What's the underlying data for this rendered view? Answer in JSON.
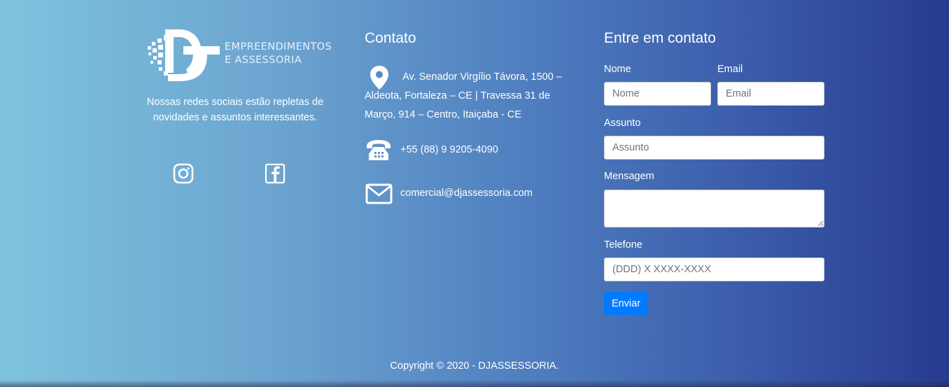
{
  "brand": {
    "logo_line1": "EMPREENDIMENTOS",
    "logo_line2": "E ASSESSORIA",
    "tagline": "Nossas redes sociais estão repletas de novidades e assuntos interessantes.",
    "social": [
      {
        "name": "instagram-icon"
      },
      {
        "name": "facebook-icon"
      }
    ]
  },
  "contact": {
    "title": "Contato",
    "address": "Av. Senador Virgílio Távora, 1500 – Aldeota, Fortaleza – CE | Travessa 31 de Março, 914 – Centro, Itaiçaba - CE",
    "phone": "+55 (88) 9 9205-4090",
    "email": "comercial@djassessoria.com",
    "icons": [
      "map-pin-icon",
      "telephone-icon",
      "envelope-icon"
    ]
  },
  "form": {
    "title": "Entre em contato",
    "name_label": "Nome",
    "name_placeholder": "Nome",
    "email_label": "Email",
    "email_placeholder": "Email",
    "subject_label": "Assunto",
    "subject_placeholder": "Assunto",
    "message_label": "Mensagem",
    "phone_label": "Telefone",
    "phone_placeholder": "(DDD) X XXXX-XXXX",
    "submit_label": "Enviar",
    "submit_color": "#007bff"
  },
  "footer": {
    "copyright": "Copyright © 2020 - DJASSESSORIA."
  },
  "colors": {
    "gradient_start": "#7fc3de",
    "gradient_end": "#273b8f"
  }
}
